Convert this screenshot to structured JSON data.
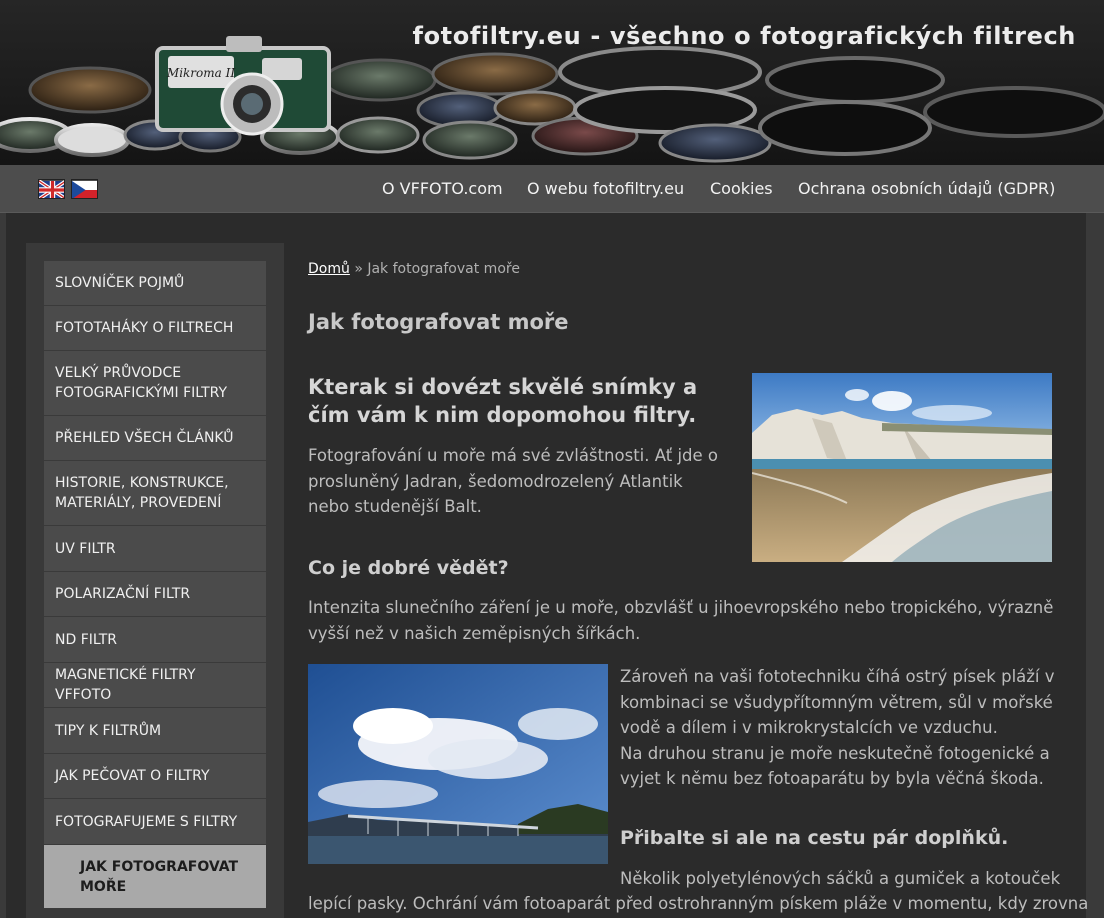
{
  "header": {
    "site_title": "fotofiltry.eu - všechno o fotografických filtrech",
    "camera_label": "Mikroma II"
  },
  "languages": [
    {
      "code": "en",
      "icon": "uk-flag-icon"
    },
    {
      "code": "cz",
      "icon": "czech-flag-icon"
    }
  ],
  "nav": {
    "items": [
      {
        "label": "O VFFOTO.com"
      },
      {
        "label": "O webu fotofiltry.eu"
      },
      {
        "label": "Cookies"
      },
      {
        "label": "Ochrana osobních údajů (GDPR)"
      }
    ]
  },
  "sidebar": {
    "items": [
      {
        "label": "Slovníček pojmů"
      },
      {
        "label": "Fototaháky o filtrech"
      },
      {
        "label": "Velký průvodce fotografickými filtry"
      },
      {
        "label": "Přehled všech článků"
      },
      {
        "label": "Historie, konstrukce, materiály, provedení"
      },
      {
        "label": "UV filtr"
      },
      {
        "label": "Polarizační filtr"
      },
      {
        "label": "ND filtr"
      },
      {
        "label": "Magnetické filtry VFFOTO"
      },
      {
        "label": "Tipy k filtrům"
      },
      {
        "label": "Jak pečovat o filtry"
      },
      {
        "label": "Fotografujeme s filtry"
      },
      {
        "label": "Jak fotografovat moře",
        "active": true
      }
    ]
  },
  "breadcrumb": {
    "home": "Domů",
    "separator": "»",
    "current": "Jak fotografovat moře"
  },
  "article": {
    "title": "Jak fotografovat moře",
    "lead_heading": "Kterak si dovézt skvělé snímky a čím vám k nim dopomohou filtry.",
    "intro": "Fotografování u moře má své zvláštnosti. Ať jde o prosluněný Jadran, šedomodrozelený Atlantik nebo studenější Balt.",
    "section1_heading": "Co je dobré vědět?",
    "section1_text": "Intenzita slunečního záření je u moře, obzvlášť u jihoevropského nebo tropického, výrazně vyšší než v našich zeměpisných šířkách.",
    "section1_text2a": "Zároveň na vaši fototechniku číhá ostrý písek pláží v kombinaci se všudypřítomným větrem, sůl v mořské vodě a dílem i v mikrokrystalcích ve vzduchu.",
    "section1_text2b": "Na druhou stranu je moře neskutečně fotogenické a vyjet k němu bez fotoaparátu by byla věčná škoda.",
    "section2_heading": "Přibalte si ale na cestu pár doplňků.",
    "section2_text_line1": "Několik polyetylénových sáčků a gumiček a kotouček",
    "section2_text_line2": "lepící pasky. Ochrání vám fotoaparát před ostrohranným pískem pláže v momentu, kdy zrovna"
  },
  "colors": {
    "page_bg": "#2b2b2b",
    "nav_bg": "#4d4d4d",
    "sidebar_item_bg": "#4b4b4b",
    "sidebar_active_bg": "#a9a9a9"
  }
}
